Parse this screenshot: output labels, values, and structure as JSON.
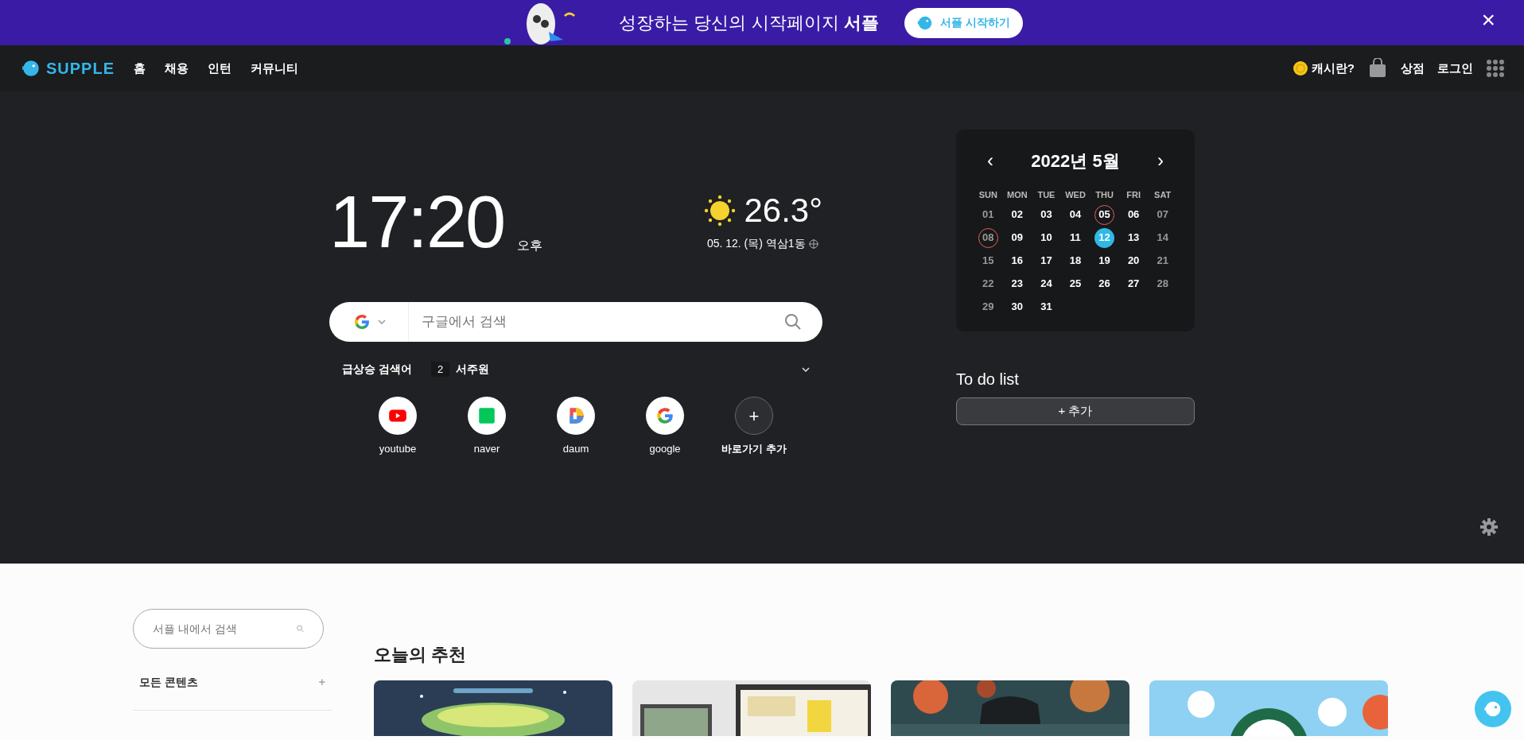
{
  "banner": {
    "text": "성장하는 당신의 시작페이지 **서플**",
    "button": "서플 시작하기",
    "close": "×"
  },
  "nav": {
    "logo": "SUPPLE",
    "items": [
      "홈",
      "채용",
      "인턴",
      "커뮤니티"
    ],
    "cash": "캐시란?",
    "store": "상점",
    "login": "로그인"
  },
  "clock": {
    "time": "17:20",
    "ampm": "오후"
  },
  "weather": {
    "temp": "26.3°",
    "detail": "05. 12. (목) 역삼1동"
  },
  "search": {
    "placeholder": "구글에서 검색"
  },
  "trending": {
    "label": "급상승 검색어",
    "rank": "2",
    "term": "서주원"
  },
  "shortcuts": [
    {
      "kind": "youtube",
      "label": "youtube"
    },
    {
      "kind": "naver",
      "label": "naver"
    },
    {
      "kind": "daum",
      "label": "daum"
    },
    {
      "kind": "google",
      "label": "google"
    },
    {
      "kind": "add",
      "label": "바로가기 추가",
      "symbol": "+"
    }
  ],
  "calendar": {
    "title": "2022년 5월",
    "prev": "‹",
    "next": "›",
    "weekdays": [
      "SUN",
      "MON",
      "TUE",
      "WED",
      "THU",
      "FRI",
      "SAT"
    ],
    "days": [
      {
        "day": "01",
        "kind": "weekend",
        "marked": false,
        "selected": false
      },
      {
        "day": "02",
        "kind": "weekday",
        "marked": false,
        "selected": false
      },
      {
        "day": "03",
        "kind": "weekday",
        "marked": false,
        "selected": false
      },
      {
        "day": "04",
        "kind": "weekday",
        "marked": false,
        "selected": false
      },
      {
        "day": "05",
        "kind": "weekday",
        "marked": true,
        "selected": false
      },
      {
        "day": "06",
        "kind": "weekday",
        "marked": false,
        "selected": false
      },
      {
        "day": "07",
        "kind": "weekend",
        "marked": false,
        "selected": false
      },
      {
        "day": "08",
        "kind": "weekend",
        "marked": true,
        "selected": false
      },
      {
        "day": "09",
        "kind": "weekday",
        "marked": false,
        "selected": false
      },
      {
        "day": "10",
        "kind": "weekday",
        "marked": false,
        "selected": false
      },
      {
        "day": "11",
        "kind": "weekday",
        "marked": false,
        "selected": false
      },
      {
        "day": "12",
        "kind": "weekday",
        "marked": false,
        "selected": true
      },
      {
        "day": "13",
        "kind": "weekday",
        "marked": false,
        "selected": false
      },
      {
        "day": "14",
        "kind": "weekend",
        "marked": false,
        "selected": false
      },
      {
        "day": "15",
        "kind": "weekend",
        "marked": false,
        "selected": false
      },
      {
        "day": "16",
        "kind": "weekday",
        "marked": false,
        "selected": false
      },
      {
        "day": "17",
        "kind": "weekday",
        "marked": false,
        "selected": false
      },
      {
        "day": "18",
        "kind": "weekday",
        "marked": false,
        "selected": false
      },
      {
        "day": "19",
        "kind": "weekday",
        "marked": false,
        "selected": false
      },
      {
        "day": "20",
        "kind": "weekday",
        "marked": false,
        "selected": false
      },
      {
        "day": "21",
        "kind": "weekend",
        "marked": false,
        "selected": false
      },
      {
        "day": "22",
        "kind": "weekend",
        "marked": false,
        "selected": false
      },
      {
        "day": "23",
        "kind": "weekday",
        "marked": false,
        "selected": false
      },
      {
        "day": "24",
        "kind": "weekday",
        "marked": false,
        "selected": false
      },
      {
        "day": "25",
        "kind": "weekday",
        "marked": false,
        "selected": false
      },
      {
        "day": "26",
        "kind": "weekday",
        "marked": false,
        "selected": false
      },
      {
        "day": "27",
        "kind": "weekday",
        "marked": false,
        "selected": false
      },
      {
        "day": "28",
        "kind": "weekend",
        "marked": false,
        "selected": false
      },
      {
        "day": "29",
        "kind": "weekend",
        "marked": false,
        "selected": false
      },
      {
        "day": "30",
        "kind": "weekday",
        "marked": false,
        "selected": false
      },
      {
        "day": "31",
        "kind": "weekday",
        "marked": false,
        "selected": false
      }
    ]
  },
  "todo": {
    "title": "To do list",
    "button": "+ 추가"
  },
  "sidebar": {
    "placeholder": "서플 내에서 검색",
    "items": [
      {
        "label": "모든 콘텐츠",
        "symbol": "+"
      }
    ]
  },
  "recommend": {
    "title": "오늘의 추천"
  }
}
